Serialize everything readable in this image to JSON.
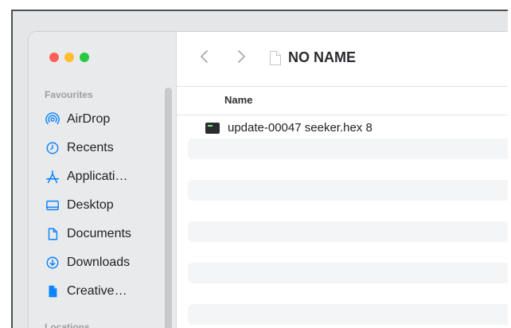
{
  "sidebar": {
    "sections": [
      {
        "label": "Favourites"
      },
      {
        "label": "Locations"
      }
    ],
    "items": [
      {
        "label": "AirDrop",
        "icon": "airdrop-icon"
      },
      {
        "label": "Recents",
        "icon": "clock-icon"
      },
      {
        "label": "Applicati…",
        "icon": "applications-icon"
      },
      {
        "label": "Desktop",
        "icon": "desktop-icon"
      },
      {
        "label": "Documents",
        "icon": "document-icon"
      },
      {
        "label": "Downloads",
        "icon": "download-icon"
      },
      {
        "label": "Creative…",
        "icon": "file-icon"
      }
    ]
  },
  "toolbar": {
    "title": "NO NAME"
  },
  "list": {
    "column_name": "Name",
    "files": [
      {
        "name": "update-00047 seeker.hex 8",
        "icon": "executable-file-icon"
      }
    ]
  },
  "colors": {
    "accent": "#0a84ff",
    "close": "#ff5f57",
    "minimize": "#febc2e",
    "zoom": "#28c840"
  }
}
